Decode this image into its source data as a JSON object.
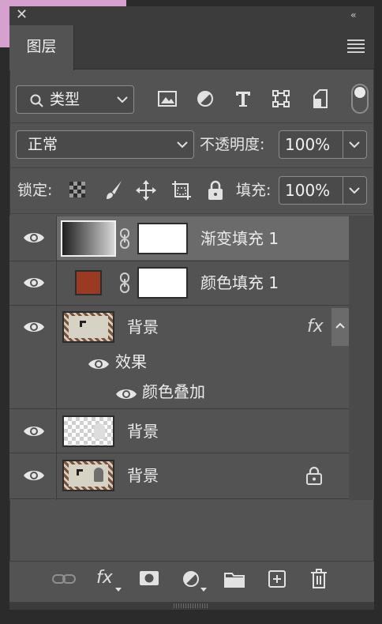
{
  "panel": {
    "tab_label": "图层"
  },
  "filter": {
    "kind_label": "类型"
  },
  "blend": {
    "mode": "正常",
    "opacity_label": "不透明度:",
    "opacity_value": "100%"
  },
  "lock": {
    "label": "锁定:",
    "fill_label": "填充:",
    "fill_value": "100%"
  },
  "layers": [
    {
      "name": "渐变填充 1"
    },
    {
      "name": "颜色填充 1",
      "swatch_color": "#9a3a22"
    },
    {
      "name": "背景",
      "fx": "fx"
    },
    {
      "name": "背景"
    },
    {
      "name": "背景"
    }
  ],
  "effects": {
    "group_label": "效果",
    "item_label": "颜色叠加"
  },
  "footer": {
    "fx_label": "fx"
  },
  "colors": {
    "panel": "#535353",
    "selected_row": "#6b6b6b",
    "header": "#3c3c3c"
  }
}
